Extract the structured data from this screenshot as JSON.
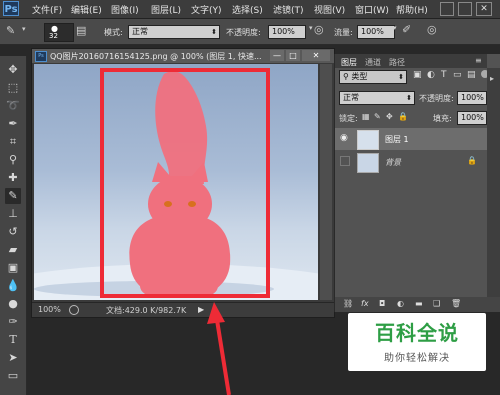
{
  "app": {
    "logo": "Ps"
  },
  "menu": [
    "文件(F)",
    "编辑(E)",
    "图像(I)",
    "图层(L)",
    "文字(Y)",
    "选择(S)",
    "滤镜(T)",
    "视图(V)",
    "窗口(W)",
    "帮助(H)"
  ],
  "options": {
    "brush_size": "32",
    "mode_label": "模式:",
    "mode_value": "正常",
    "opacity_label": "不透明度:",
    "opacity_value": "100%",
    "flow_label": "流量:",
    "flow_value": "100%"
  },
  "document": {
    "title": "QQ图片20160716154125.png @ 100% (图层 1, 快速...",
    "zoom": "100%",
    "doc_info": "文档:429.0 K/982.7K"
  },
  "layers_panel": {
    "tabs": [
      "图层",
      "通道",
      "路径"
    ],
    "filter_kind": "类型",
    "blend_mode": "正常",
    "opacity_label": "不透明度:",
    "opacity_value": "100%",
    "lock_label": "锁定:",
    "fill_label": "填充:",
    "fill_value": "100%",
    "layers": [
      {
        "name": "图层 1",
        "visible": true,
        "selected": true
      },
      {
        "name": "背景",
        "visible": false,
        "locked": true
      }
    ]
  },
  "watermark": {
    "title": "百科全说",
    "subtitle": "助你轻松解决"
  },
  "colors": {
    "annotation_red": "#ee2b36",
    "selection_pink": "#f0707e",
    "watermark_green": "#2e9e45"
  }
}
